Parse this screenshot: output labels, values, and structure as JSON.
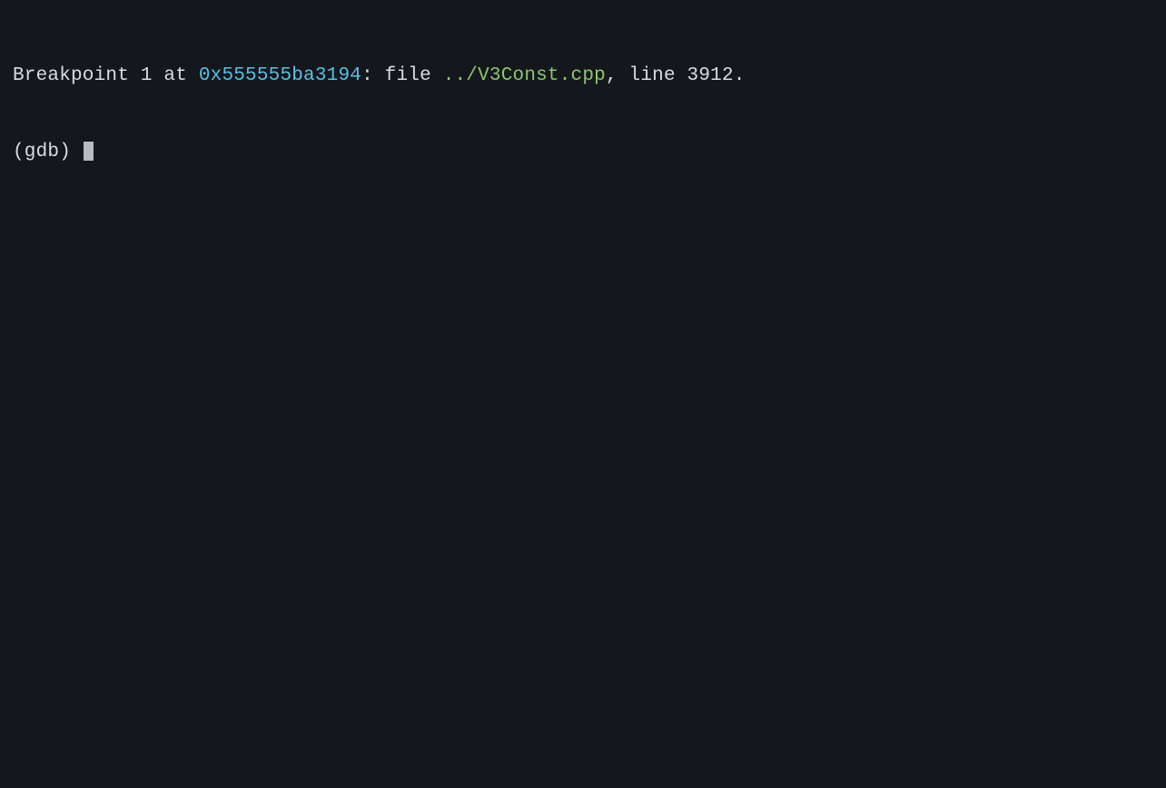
{
  "output": {
    "line1": {
      "prefix": "Breakpoint 1 at ",
      "address": "0x555555ba3194",
      "mid": ": file ",
      "file": "../V3Const.cpp",
      "suffix": ", line 3912."
    }
  },
  "prompt": {
    "text": "(gdb) "
  },
  "colors": {
    "background": "#14171c",
    "text": "#d8dde3",
    "address": "#56c2e6",
    "file": "#8cc76e",
    "cursor": "#b7bcc2"
  }
}
